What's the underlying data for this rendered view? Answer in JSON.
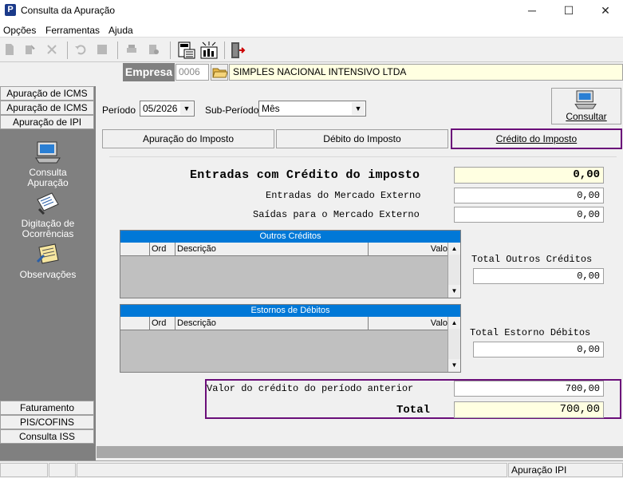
{
  "window": {
    "title": "Consulta da Apuração",
    "app_icon_letter": "P",
    "minimize": "─",
    "maximize": "☐",
    "close": "✕"
  },
  "menu": {
    "items": [
      "Opções",
      "Ferramentas",
      "Ajuda"
    ]
  },
  "empresa": {
    "label": "Empresa",
    "code": "0006",
    "name": "SIMPLES NACIONAL INTENSIVO LTDA"
  },
  "sidebar": {
    "top_buttons": [
      "Apuração de ICMS",
      "Apuração de ICMS ST",
      "Apuração de IPI"
    ],
    "tools": [
      "Consulta Apuração",
      "Digitação de Ocorrências",
      "Observações"
    ],
    "bottom_buttons": [
      "Faturamento",
      "PIS/COFINS",
      "Consulta ISS"
    ]
  },
  "filters": {
    "periodo_label": "Período",
    "periodo_value": "05/2026",
    "subperiodo_label": "Sub-Período",
    "subperiodo_value": "Mês",
    "consultar_label": "Consultar"
  },
  "tabs": [
    "Apuração do Imposto",
    "Débito do Imposto",
    "Crédito do Imposto"
  ],
  "credit": {
    "entradas_credito_label": "Entradas com Crédito do imposto",
    "entradas_credito_value": "0,00",
    "entradas_externo_label": "Entradas do Mercado Externo",
    "entradas_externo_value": "0,00",
    "saidas_externo_label": "Saídas para o Mercado Externo",
    "saidas_externo_value": "0,00",
    "outros_creditos_title": "Outros Créditos",
    "estornos_title": "Estornos de Débitos",
    "grid_cols": [
      "Ord",
      "Descrição",
      "Valo"
    ],
    "total_outros_label": "Total Outros Créditos",
    "total_outros_value": "0,00",
    "total_estorno_label": "Total Estorno Débitos",
    "total_estorno_value": "0,00",
    "valor_anterior_label": "Valor do crédito do período anterior",
    "valor_anterior_value": "700,00",
    "total_label": "Total",
    "total_value": "700,00"
  },
  "status": {
    "right": "Apuração IPI"
  },
  "colors": {
    "highlight": "#6a0e79",
    "grid_header": "#0078d7",
    "yellow_field": "#ffffe1"
  }
}
